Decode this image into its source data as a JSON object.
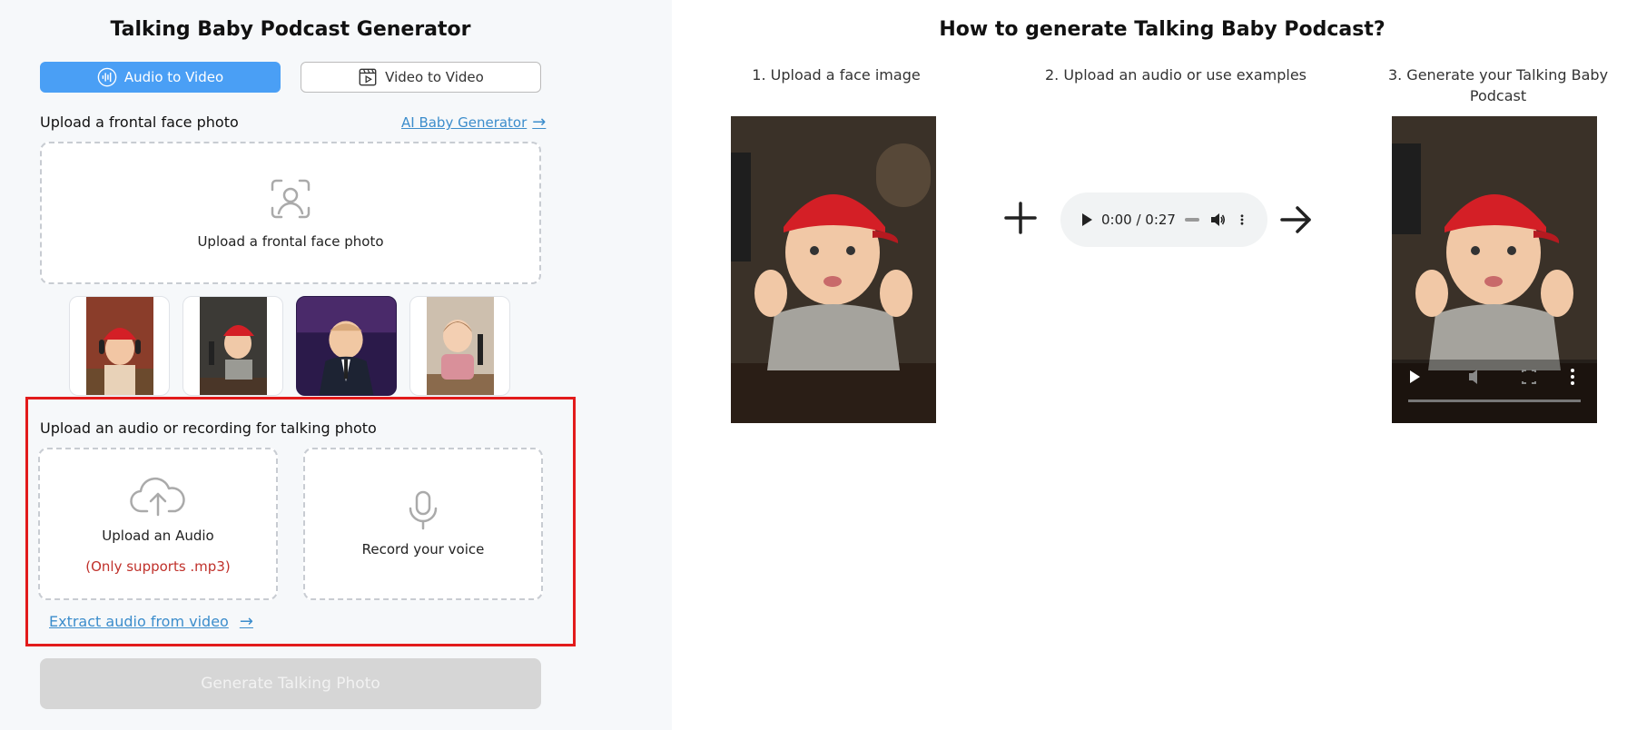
{
  "left_panel": {
    "title": "Talking Baby Podcast Generator",
    "modes": [
      {
        "label": "Audio to Video",
        "icon": "waveform-icon",
        "active": true
      },
      {
        "label": "Video to Video",
        "icon": "film-icon",
        "active": false
      }
    ],
    "face": {
      "label": "Upload a frontal face photo",
      "generator_link": "AI Baby Generator",
      "dropzone_text": "Upload a frontal face photo",
      "dropzone_icon": "face-scan-icon"
    },
    "examples": [
      {
        "name": "baby with headphones and red cap"
      },
      {
        "name": "baby in red cap at microphone"
      },
      {
        "name": "baby in suit on stage"
      },
      {
        "name": "toddler girl at microphone"
      }
    ],
    "audio": {
      "label": "Upload an audio or recording for talking photo",
      "upload_text": "Upload an Audio",
      "upload_note": "(Only supports .mp3)",
      "upload_icon": "cloud-upload-icon",
      "record_text": "Record your voice",
      "record_icon": "microphone-icon",
      "extract_link": "Extract audio from video"
    },
    "generate_button": "Generate Talking Photo"
  },
  "right_panel": {
    "title": "How to generate Talking Baby Podcast?",
    "steps": [
      "1. Upload a face image",
      "2. Upload an audio or use examples",
      "3. Generate your Talking Baby Podcast"
    ],
    "player": {
      "time": "0:00 / 0:27"
    }
  },
  "colors": {
    "accent": "#4a9ff5",
    "link": "#3c8dcc",
    "highlight_border": "#e21b1b",
    "note_red": "#c0312b",
    "disabled_button": "#d6d6d6"
  }
}
